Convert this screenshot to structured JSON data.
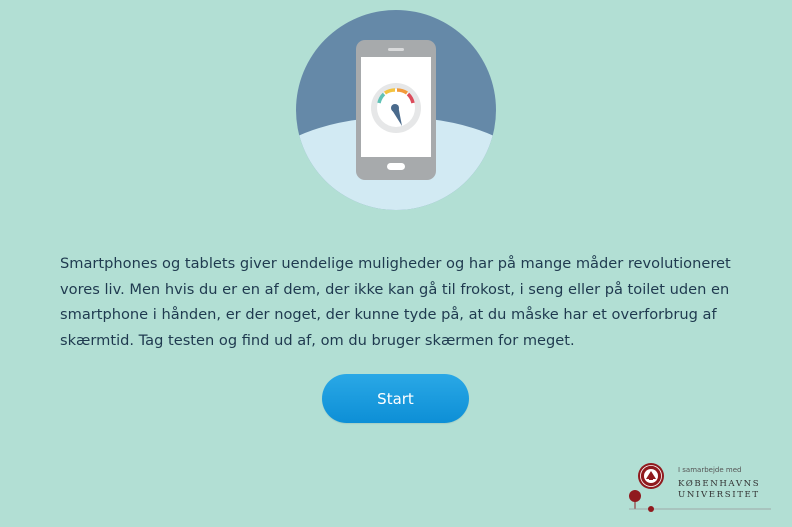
{
  "hero": {
    "icon": "smartphone-speedometer-illustration",
    "colors": {
      "circle_top": "#6589a8",
      "circle_bottom": "#d2eaf3",
      "phone_body": "#a7aaac",
      "screen": "#ffffff"
    }
  },
  "intro_text": "Smartphones og tablets giver uendelige muligheder og har på mange måder revolutioneret vores liv. Men hvis du er en af dem, der ikke kan gå til frokost, i seng eller på toilet uden en smartphone i hånden, er der noget, der kunne tyde på, at du måske har et overforbrug af skærmtid. Tag testen og find ud af, om du bruger skærmen for meget.",
  "start_button": {
    "label": "Start",
    "color": "#1a9bde"
  },
  "partner": {
    "tagline": "I samarbejde med",
    "name_line1": "KØBENHAVNS",
    "name_line2": "UNIVERSITET",
    "accent_color": "#901a1e",
    "icon": "ku-seal-icon"
  },
  "background_color": "#b2dfd4"
}
